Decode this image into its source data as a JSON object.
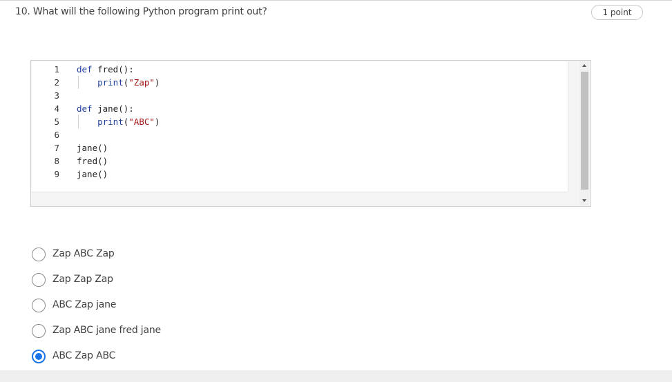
{
  "question": {
    "text": "10. What will the following Python program print out?",
    "points": "1 point"
  },
  "code_editor": {
    "lines": [
      {
        "num": "1",
        "tokens": [
          {
            "t": "def ",
            "k": "kw"
          },
          {
            "t": "fred():",
            "k": ""
          }
        ]
      },
      {
        "num": "2",
        "tokens": [
          {
            "t": "    ",
            "k": ""
          },
          {
            "t": "print",
            "k": "kw"
          },
          {
            "t": "(",
            "k": ""
          },
          {
            "t": "\"Zap\"",
            "k": "str"
          },
          {
            "t": ")",
            "k": ""
          }
        ]
      },
      {
        "num": "3",
        "tokens": []
      },
      {
        "num": "4",
        "tokens": [
          {
            "t": "def ",
            "k": "kw"
          },
          {
            "t": "jane():",
            "k": ""
          }
        ]
      },
      {
        "num": "5",
        "tokens": [
          {
            "t": "    ",
            "k": ""
          },
          {
            "t": "print",
            "k": "kw"
          },
          {
            "t": "(",
            "k": ""
          },
          {
            "t": "\"ABC\"",
            "k": "str"
          },
          {
            "t": ")",
            "k": ""
          }
        ]
      },
      {
        "num": "6",
        "tokens": []
      },
      {
        "num": "7",
        "tokens": [
          {
            "t": "jane()",
            "k": ""
          }
        ]
      },
      {
        "num": "8",
        "tokens": [
          {
            "t": "fred()",
            "k": ""
          }
        ]
      },
      {
        "num": "9",
        "tokens": [
          {
            "t": "jane()",
            "k": ""
          }
        ]
      }
    ]
  },
  "options": [
    {
      "label": "Zap ABC Zap",
      "selected": false
    },
    {
      "label": "Zap Zap Zap",
      "selected": false
    },
    {
      "label": "ABC Zap jane",
      "selected": false
    },
    {
      "label": "Zap ABC jane fred jane",
      "selected": false
    },
    {
      "label": "ABC Zap ABC",
      "selected": true
    }
  ],
  "colors": {
    "accent": "#1a73e8",
    "keyword": "#1f3f9e",
    "string": "#a31515"
  }
}
